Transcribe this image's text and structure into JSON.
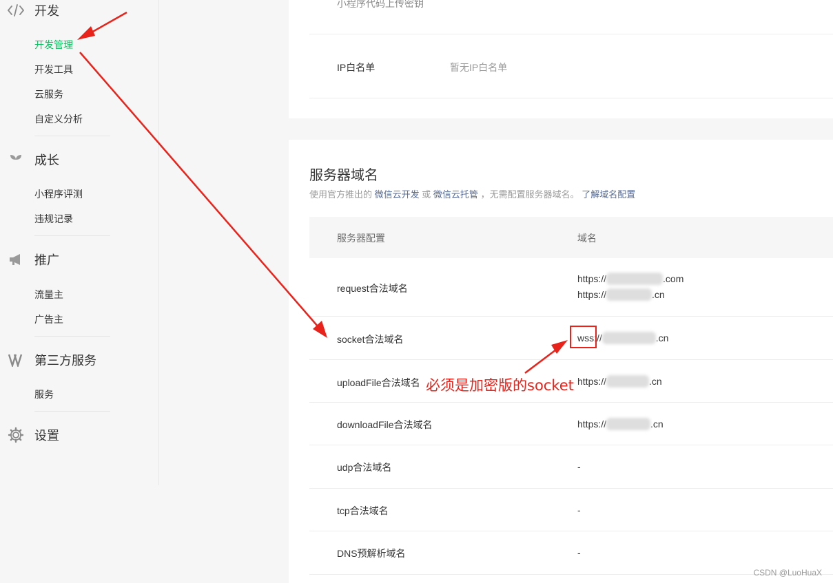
{
  "sidebar": {
    "groups": [
      {
        "icon": "code-icon",
        "title": "开发",
        "items": [
          "开发管理",
          "开发工具",
          "云服务",
          "自定义分析"
        ],
        "active": "开发管理"
      },
      {
        "icon": "sprout-icon",
        "title": "成长",
        "items": [
          "小程序评测",
          "违规记录"
        ]
      },
      {
        "icon": "megaphone-icon",
        "title": "推广",
        "items": [
          "流量主",
          "广告主"
        ]
      },
      {
        "icon": "third-party-icon",
        "title": "第三方服务",
        "items": [
          "服务"
        ]
      },
      {
        "icon": "gear-icon",
        "title": "设置",
        "items": []
      }
    ]
  },
  "top_panel": {
    "upload_key_label": "小程序代码上传密钥",
    "ip_whitelist_label": "IP白名单",
    "ip_whitelist_value": "暂无IP白名单"
  },
  "domains": {
    "title": "服务器域名",
    "desc_prefix": "使用官方推出的",
    "desc_link1": "微信云开发",
    "desc_or": "或",
    "desc_link2": "微信云托管",
    "desc_mid": "，无需配置服务器域名。",
    "desc_link3": "了解域名配置",
    "col_config": "服务器配置",
    "col_domain": "域名",
    "rows": [
      {
        "name": "request合法域名",
        "domains": [
          {
            "prefix": "https://",
            "suffix": ".com"
          },
          {
            "prefix": "https://",
            "suffix": ".cn"
          }
        ]
      },
      {
        "name": "socket合法域名",
        "domains": [
          {
            "prefix": "wss://",
            "suffix": ".cn"
          }
        ]
      },
      {
        "name": "uploadFile合法域名",
        "domains": [
          {
            "prefix": "https://",
            "suffix": ".cn"
          }
        ]
      },
      {
        "name": "downloadFile合法域名",
        "domains": [
          {
            "prefix": "https://",
            "suffix": ".cn"
          }
        ]
      },
      {
        "name": "udp合法域名",
        "value": "-"
      },
      {
        "name": "tcp合法域名",
        "value": "-"
      },
      {
        "name": "DNS预解析域名",
        "value": "-"
      }
    ]
  },
  "annotation": {
    "text": "必须是加密版的socket",
    "color": "#e8231b"
  },
  "watermark": "CSDN @LuoHuaX"
}
